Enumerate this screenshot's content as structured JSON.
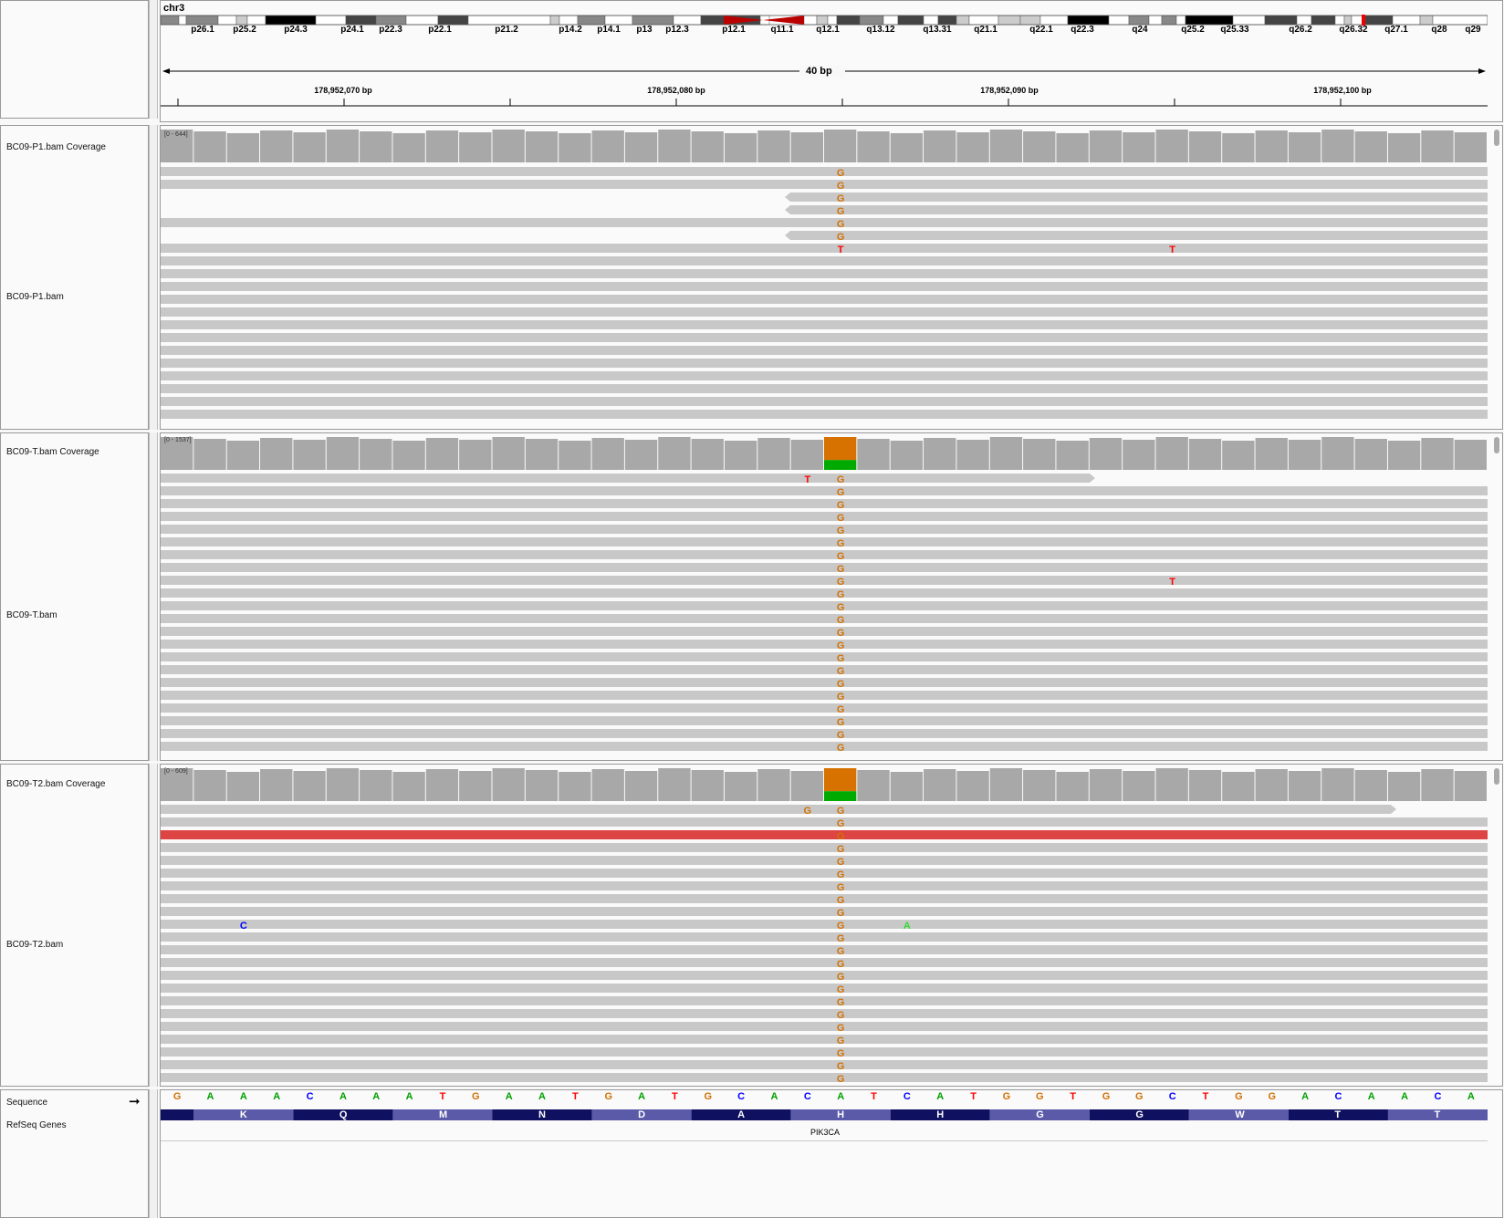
{
  "header": {
    "chromosome": "chr3",
    "bands": [
      "p26.1",
      "p25.2",
      "p24.3",
      "p24.1",
      "p22.3",
      "p22.1",
      "p21.2",
      "p14.2",
      "p14.1",
      "p13",
      "p12.3",
      "p12.1",
      "q11.1",
      "q12.1",
      "q13.12",
      "q13.31",
      "q21.1",
      "q22.1",
      "q22.3",
      "q24",
      "q25.2",
      "q25.33",
      "q26.2",
      "q26.32",
      "q27.1",
      "q28",
      "q29"
    ],
    "span_label": "40 bp",
    "ruler": [
      "178,952,070 bp",
      "178,952,080 bp",
      "178,952,090 bp",
      "178,952,100 bp"
    ]
  },
  "tracks": [
    {
      "coverage_label": "BC09-P1.bam Coverage",
      "reads_label": "BC09-P1.bam",
      "range": "[0 - 644]"
    },
    {
      "coverage_label": "BC09-T.bam Coverage",
      "reads_label": "BC09-T.bam",
      "range": "[0 - 1537]"
    },
    {
      "coverage_label": "BC09-T2.bam Coverage",
      "reads_label": "BC09-T2.bam",
      "range": "[0 - 609]"
    }
  ],
  "sequence": {
    "label": "Sequence",
    "bases": [
      "G",
      "A",
      "A",
      "A",
      "C",
      "A",
      "A",
      "A",
      "T",
      "G",
      "A",
      "A",
      "T",
      "G",
      "A",
      "T",
      "G",
      "C",
      "A",
      "C",
      "A",
      "T",
      "C",
      "A",
      "T",
      "G",
      "G",
      "T",
      "G",
      "G",
      "C",
      "T",
      "G",
      "G",
      "A",
      "C",
      "A",
      "A",
      "C",
      "A"
    ]
  },
  "genes": {
    "label": "RefSeq Genes",
    "gene_name": "PIK3CA",
    "amino_acids": [
      "K",
      "Q",
      "M",
      "N",
      "D",
      "A",
      "H",
      "H",
      "G",
      "G",
      "W",
      "T",
      "T"
    ]
  },
  "colors": {
    "A": "#00a000",
    "C": "#0000ff",
    "G": "#d17105",
    "T": "#ff0000",
    "read": "#c8c8c8",
    "coverage": "#a8a8a8",
    "highlight_read": "#dd4444"
  }
}
